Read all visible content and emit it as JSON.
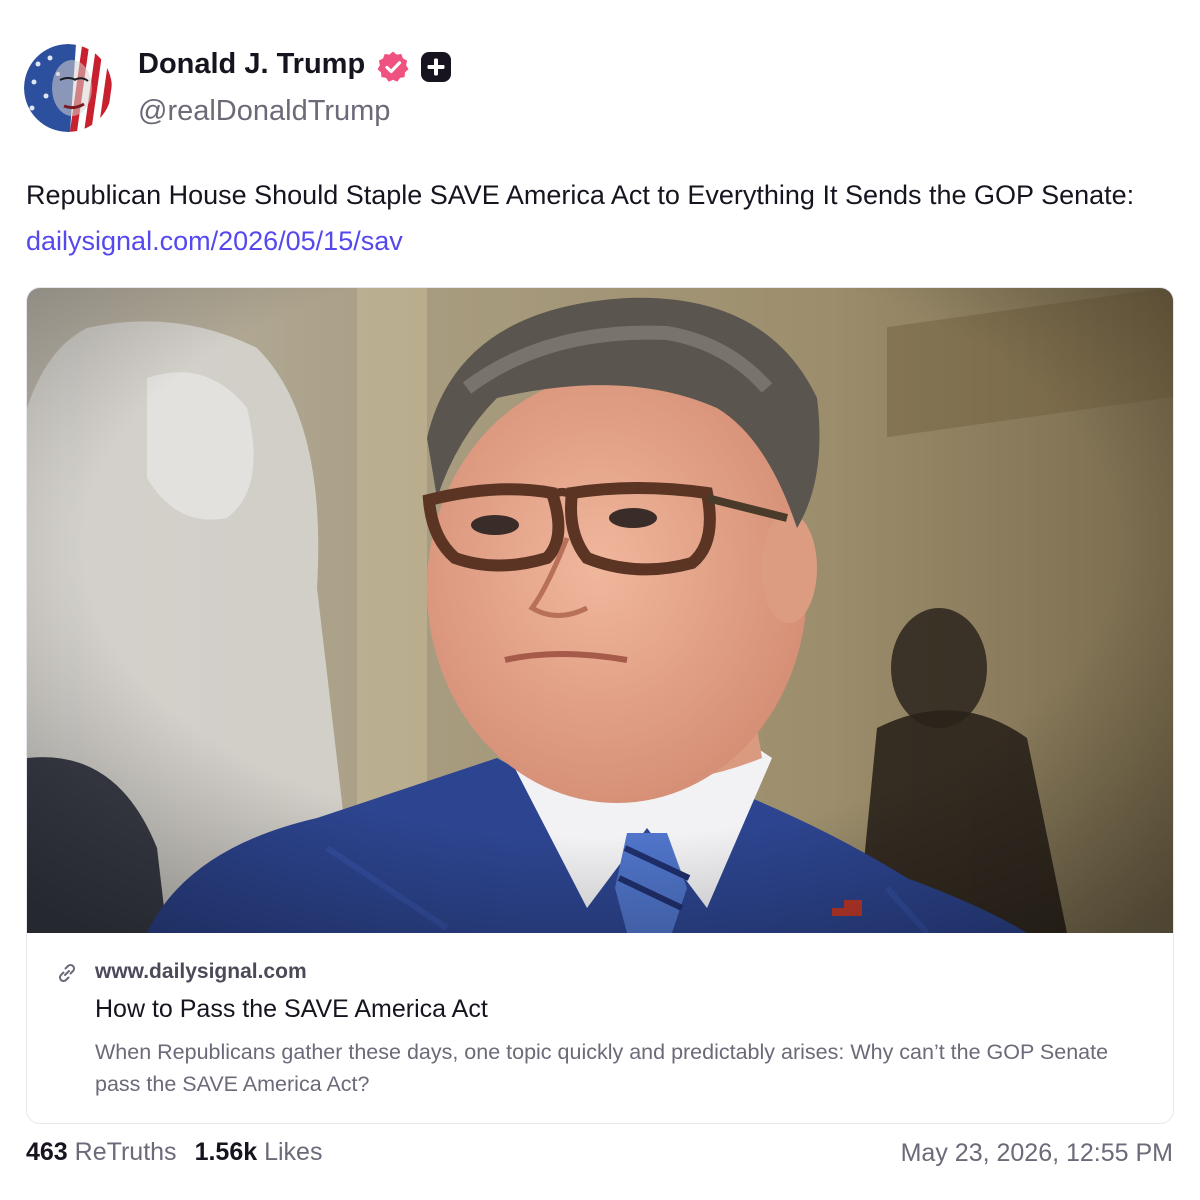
{
  "author": {
    "display_name": "Donald J. Trump",
    "handle": "@realDonaldTrump",
    "avatar_icon": "flag-face-avatar",
    "verified_icon": "verified-badge-icon",
    "verified_color": "#f0527f",
    "plus_icon": "plus-badge-icon"
  },
  "post": {
    "text": "Republican House Should Staple SAVE America Act to Everything It Sends the GOP Senate: ",
    "link_text": "dailysignal.com/2026/05/15/sav",
    "link_color": "#5448ee"
  },
  "card": {
    "image_alt": "photo-man-in-glasses-blue-suit",
    "link_icon": "link-icon",
    "domain": "www.dailysignal.com",
    "title": "How to Pass the SAVE America Act",
    "description": "When Republicans gather these days, one topic quickly and predictably arises: Why can’t the GOP Senate pass the SAVE America Act?"
  },
  "stats": {
    "retruths_count": "463",
    "retruths_label": "ReTruths",
    "likes_count": "1.56k",
    "likes_label": "Likes"
  },
  "timestamp": "May 23, 2026, 12:55 PM"
}
